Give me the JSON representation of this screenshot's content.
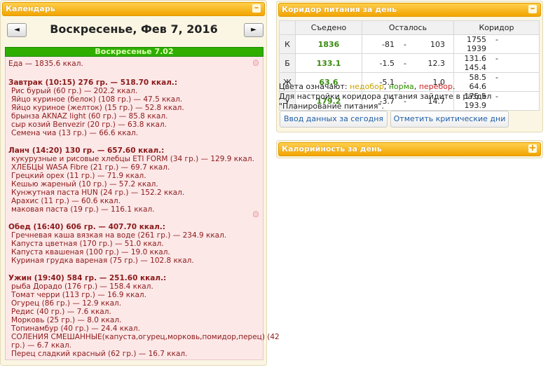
{
  "calendar": {
    "title": "Календарь",
    "toggle": "–",
    "prev": "◄",
    "next": "►",
    "date": "Воскресенье, Фев 7, 2016",
    "day_bar": "Воскресенье 7.02"
  },
  "diary": {
    "food_total": "Еда — 1835.6 ккал.",
    "meals": [
      {
        "header": "Завтрак (10:15) 276 гр. — 518.70 ккал.:",
        "items": [
          "Рис бурый (60 гр.) — 202.2 ккал.",
          "Яйцо куриное (белок) (108 гр.) — 47.5 ккал.",
          "Яйцо куриное (желток) (15 гр.) — 52.8 ккал.",
          "брынза AKNAZ light (60 гр.) — 85.8 ккал.",
          "сыр козий Benvezir (20 гр.) — 63.8 ккал.",
          "Семена чиа (13 гр.) — 66.6 ккал."
        ]
      },
      {
        "header": "Ланч (14:20) 130 гр. — 657.60 ккал.:",
        "items": [
          "кукурузные и рисовые хлебцы ETI FORM (34 гр.) — 129.9 ккал.",
          "ХЛЕБЦЫ WASA Fibre (21 гр.) — 69.7 ккал.",
          "Грецкий орех (11 гр.) — 71.9 ккал.",
          "Кешью жареный (10 гр.) — 57.2 ккал.",
          "Кунжутная паста HUN (24 гр.) — 152.2 ккал.",
          "Арахис (11 гр.) — 60.6 ккал.",
          "маковая паста (19 гр.) — 116.1 ккал."
        ]
      },
      {
        "header": "Обед (16:40) 606 гр. — 407.70 ккал.:",
        "items": [
          "Гречневая каша вязкая на воде (261 гр.) — 234.9 ккал.",
          "Капуста цветная (170 гр.) — 51.0 ккал.",
          "Капуста квашеная (100 гр.) — 19.0 ккал.",
          "Куриная грудка вареная (75 гр.) — 102.8 ккал."
        ]
      },
      {
        "header": "Ужин (19:40) 584 гр. — 251.60 ккал.:",
        "items": [
          "рыба Дорадо (176 гр.) — 158.4 ккал.",
          "Томат черри (113 гр.) — 16.9 ккал.",
          "Огурец (86 гр.) — 12.9 ккал.",
          "Редис (40 гр.) — 7.6 ккал.",
          "Морковь (25 гр.) — 8.0 ккал.",
          "Топинамбур (40 гр.) — 24.4 ккал.",
          "СОЛЕНИЯ СМЕШАННЫЕ(капуста,огурец,морковь,помидор,перец) (42",
          "гр.) — 6.7 ккал.",
          "Перец сладкий красный (62 гр.) — 16.7 ккал."
        ]
      }
    ]
  },
  "corridor": {
    "title": "Коридор питания за день",
    "toggle": "–",
    "headers": [
      "",
      "Съедено",
      "Осталось",
      "Коридор"
    ],
    "rows": [
      {
        "label": "К",
        "eaten": "1836",
        "left_min": "-81",
        "left_max": "103",
        "cor_min": "1755",
        "cor_max": "1939"
      },
      {
        "label": "Б",
        "eaten": "133.1",
        "left_min": "-1.5",
        "left_max": "12.3",
        "cor_min": "131.6",
        "cor_max": "145.4"
      },
      {
        "label": "Ж",
        "eaten": "63.6",
        "left_min": "-5.1",
        "left_max": "1.0",
        "cor_min": "58.5",
        "cor_max": "64.6"
      },
      {
        "label": "У",
        "eaten": "179.2",
        "left_min": "-3.7",
        "left_max": "14.7",
        "cor_min": "175.5",
        "cor_max": "193.9"
      }
    ],
    "dash": "-",
    "legend_prefix": "Цвета означают: ",
    "legend_under": "недобор",
    "legend_norm": "норма",
    "legend_over": "перебор",
    "sep": ", ",
    "dot": ".",
    "note": "Для настройки коридора питания зайдите в раздел \"Планирование питания\".",
    "btn_enter": "Ввод данных за сегодня",
    "btn_critical": "Отметить критические дни"
  },
  "calorie": {
    "title": "Калорийность за день",
    "toggle": "+"
  },
  "colors": {
    "header_orange": "#f2a400",
    "day_green": "#2fae00",
    "under": "#caa200",
    "norm": "#2f8f00",
    "over": "#c22222"
  }
}
